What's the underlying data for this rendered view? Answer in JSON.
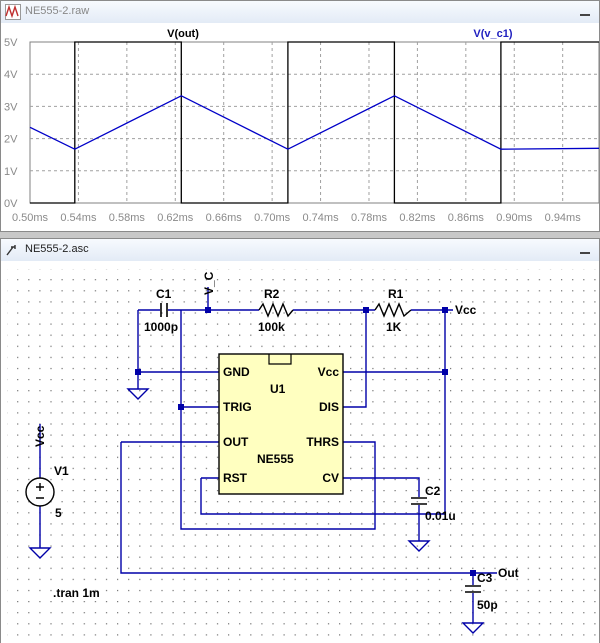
{
  "waveform": {
    "title": "NE555-2.raw",
    "trace_out_label": "V(out)",
    "trace_vc_label": "V(v_c1)",
    "colors": {
      "out": "#000000",
      "vc": "#0000c8",
      "axis_text": "#8a8a8a",
      "grid": "#a0a0a0"
    },
    "y_ticks": [
      "5V",
      "4V",
      "3V",
      "2V",
      "1V",
      "0V"
    ],
    "x_ticks": [
      "0.50ms",
      "0.54ms",
      "0.58ms",
      "0.62ms",
      "0.66ms",
      "0.70ms",
      "0.74ms",
      "0.78ms",
      "0.82ms",
      "0.86ms",
      "0.90ms",
      "0.94ms"
    ]
  },
  "chart_data": {
    "type": "line",
    "xlabel": "",
    "ylabel": "",
    "xlim": [
      0.5,
      0.97
    ],
    "ylim": [
      0,
      5
    ],
    "grid": true,
    "series": [
      {
        "name": "V(out)",
        "x": [
          0.5,
          0.537,
          0.537,
          0.625,
          0.625,
          0.713,
          0.713,
          0.801,
          0.801,
          0.889,
          0.889,
          0.97
        ],
        "y": [
          0,
          0,
          5,
          5,
          0,
          0,
          5,
          5,
          0,
          0,
          5,
          5
        ]
      },
      {
        "name": "V(v_c1)",
        "x": [
          0.5,
          0.537,
          0.625,
          0.713,
          0.801,
          0.889,
          0.97
        ],
        "y": [
          2.35,
          1.67,
          3.33,
          1.67,
          3.33,
          1.67,
          1.7
        ]
      }
    ]
  },
  "schematic": {
    "title": "NE555-2.asc",
    "ic": {
      "ref": "U1",
      "name": "NE555",
      "pins": {
        "gnd": "GND",
        "trig": "TRIG",
        "out": "OUT",
        "rst": "RST",
        "vcc": "Vcc",
        "dis": "DIS",
        "thrs": "THRS",
        "cv": "CV"
      }
    },
    "c1": {
      "ref": "C1",
      "value": "1000p"
    },
    "r2": {
      "ref": "R2",
      "value": "100k"
    },
    "r1": {
      "ref": "R1",
      "value": "1K"
    },
    "c2": {
      "ref": "C2",
      "value": "0.01u"
    },
    "c3": {
      "ref": "C3",
      "value": "50p"
    },
    "v1": {
      "ref": "V1",
      "value": "5"
    },
    "labels": {
      "vcc_top": "Vcc",
      "vcc_left": "Vcc",
      "vc": "V_C",
      "out": "Out"
    },
    "directive": ".tran 1m"
  }
}
